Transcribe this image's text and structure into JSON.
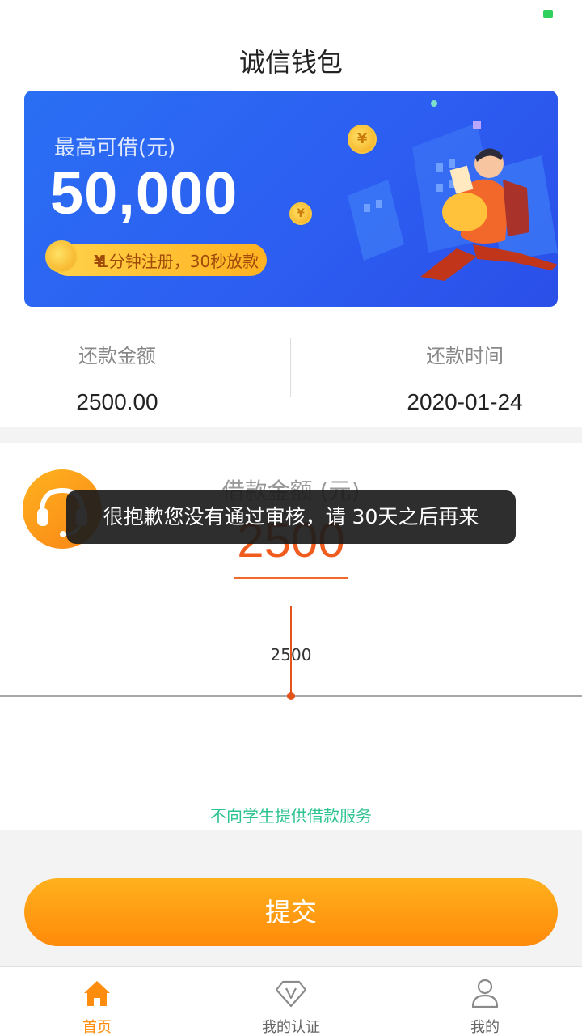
{
  "header": {
    "title": "诚信钱包"
  },
  "banner": {
    "subtitle": "最高可借(元)",
    "amount": "50,000",
    "pill_text": "1分钟注册，30秒放款",
    "coin_symbol": "¥"
  },
  "stats": {
    "repay_amount_label": "还款金额",
    "repay_amount_value": "2500.00",
    "repay_date_label": "还款时间",
    "repay_date_value": "2020-01-24"
  },
  "loan": {
    "title": "借款金额 (元)",
    "amount": "2500",
    "slider_value": "2500",
    "slider_level": 0.5,
    "notice": "不向学生提供借款服务"
  },
  "toast": {
    "message": "很抱歉您没有通过审核，请 30天之后再来"
  },
  "submit_label": "提交",
  "tabs": [
    {
      "label": "首页",
      "icon": "home-icon",
      "active": true
    },
    {
      "label": "我的认证",
      "icon": "diamond-v-icon",
      "active": false
    },
    {
      "label": "我的",
      "icon": "user-icon",
      "active": false
    }
  ],
  "colors": {
    "accent": "#ff8d0d",
    "amount": "#f05b1e",
    "banner": "#2d5ef2",
    "notice": "#2cc38f"
  }
}
